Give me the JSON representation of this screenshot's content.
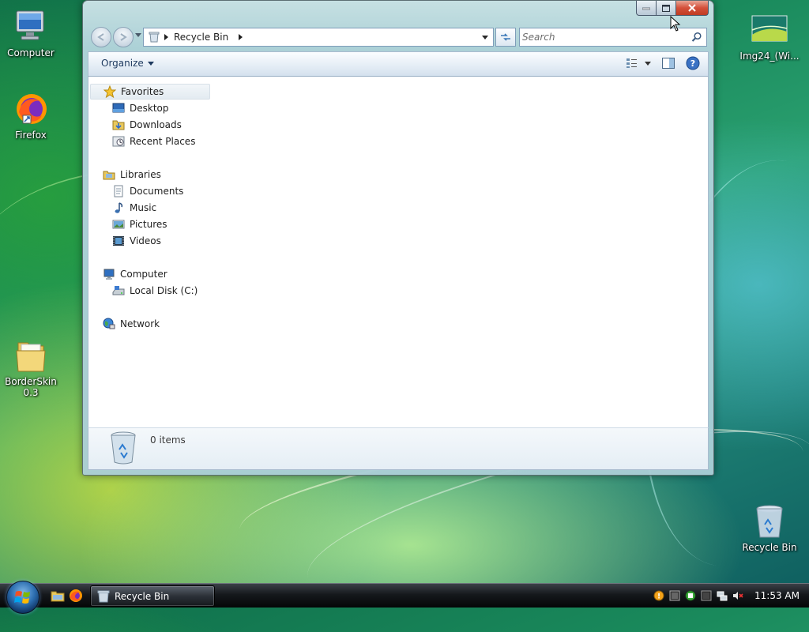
{
  "desktop": {
    "icons": {
      "computer": "Computer",
      "firefox": "Firefox",
      "borderskin": "BorderSkin 0.3",
      "img24": "Img24_(Wi...",
      "recycle": "Recycle Bin"
    }
  },
  "window": {
    "address": {
      "location": "Recycle Bin"
    },
    "search": {
      "placeholder": "Search"
    },
    "toolbar": {
      "organize_label": "Organize"
    },
    "nav": {
      "favorites": "Favorites",
      "desktop": "Desktop",
      "downloads": "Downloads",
      "recent_places": "Recent Places",
      "libraries": "Libraries",
      "documents": "Documents",
      "music": "Music",
      "pictures": "Pictures",
      "videos": "Videos",
      "computer": "Computer",
      "local_disk": "Local Disk (C:)",
      "network": "Network"
    },
    "details": {
      "item_count": "0 items"
    }
  },
  "taskbar": {
    "task_label": "Recycle Bin",
    "clock": "11:53 AM"
  },
  "colors": {
    "accent": "#2d6fb1",
    "close_button": "#c03a22",
    "link_text": "#1e3a5f"
  }
}
